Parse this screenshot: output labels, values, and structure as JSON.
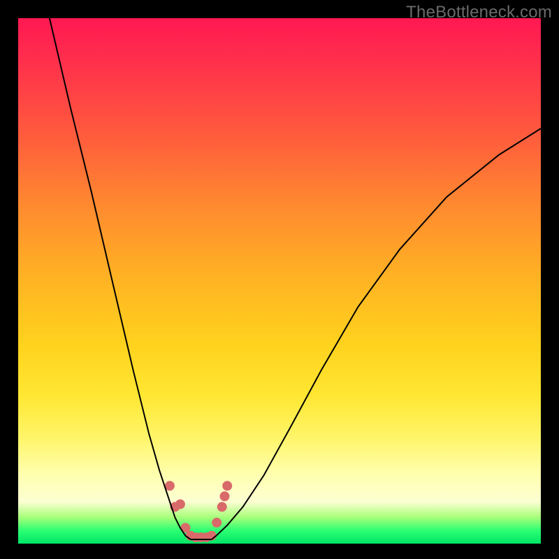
{
  "watermark": "TheBottleneck.com",
  "chart_data": {
    "type": "line",
    "title": "",
    "xlabel": "",
    "ylabel": "",
    "xlim": [
      0,
      100
    ],
    "ylim": [
      0,
      100
    ],
    "curve_left": {
      "description": "Steep descending curve from top-left toward a minimum near x≈33",
      "x": [
        6,
        10,
        14,
        18,
        22,
        25,
        27,
        29,
        30,
        31,
        32,
        33
      ],
      "y": [
        100,
        83,
        67,
        50,
        33,
        21,
        14,
        8,
        5,
        3,
        1.5,
        0.8
      ]
    },
    "curve_right": {
      "description": "Ascending curve from the minimum near x≈37 toward upper right, flattening",
      "x": [
        37,
        38,
        40,
        43,
        47,
        52,
        58,
        65,
        73,
        82,
        92,
        100
      ],
      "y": [
        0.8,
        1.6,
        3.5,
        7,
        13,
        22,
        33,
        45,
        56,
        66,
        74,
        79
      ]
    },
    "valley_floor": {
      "x_range": [
        33,
        37
      ],
      "y": 0.8
    },
    "valley_markers": {
      "description": "Soft salmon dots/dashes clustered at the bottom of the V near x≈30–40",
      "points": [
        {
          "x": 29,
          "y": 11
        },
        {
          "x": 30,
          "y": 7
        },
        {
          "x": 31,
          "y": 7.5
        },
        {
          "x": 32,
          "y": 3
        },
        {
          "x": 33,
          "y": 1.5
        },
        {
          "x": 34,
          "y": 1.2
        },
        {
          "x": 35,
          "y": 1.2
        },
        {
          "x": 36,
          "y": 1.2
        },
        {
          "x": 37,
          "y": 1.5
        },
        {
          "x": 38,
          "y": 4
        },
        {
          "x": 39,
          "y": 7
        },
        {
          "x": 39.5,
          "y": 9
        },
        {
          "x": 40,
          "y": 11
        }
      ]
    },
    "colors": {
      "curve": "#000000",
      "markers": "#d96a6a",
      "gradient_top": "#ff1852",
      "gradient_bottom": "#00e465"
    }
  }
}
